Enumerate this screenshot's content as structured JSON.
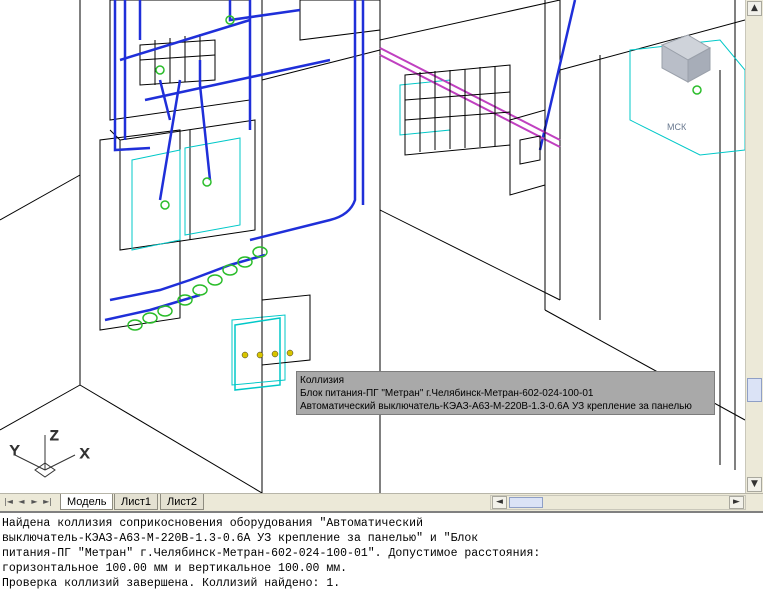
{
  "viewcube": {
    "label": "МСК"
  },
  "ucs": {
    "x": "X",
    "y": "Y",
    "z": "Z"
  },
  "tooltip": {
    "title": "Коллизия",
    "line1": "Блок питания-ПГ \"Метран\" г.Челябинск-Метран-602-024-100-01",
    "line2": "Автоматический выключатель-КЭАЗ-А63-М-220В-1.3-0.6А УЗ крепление за панелью"
  },
  "layout_tabs": [
    {
      "label": "Модель",
      "active": true
    },
    {
      "label": "Лист1",
      "active": false
    },
    {
      "label": "Лист2",
      "active": false
    }
  ],
  "nav_buttons": [
    "first-icon",
    "prev-icon",
    "next-icon",
    "last-icon"
  ],
  "scroll_arrows": {
    "up": "▲",
    "down": "▼",
    "left": "◄",
    "right": "►"
  },
  "command_line": [
    "Найдена коллизия соприкосновения оборудования \"Автоматический",
    "выключатель-КЭАЗ-А63-М-220В-1.3-0.6А УЗ крепление за панелью\" и \"Блок",
    "питания-ПГ \"Метран\" г.Челябинск-Метран-602-024-100-01\". Допустимое расстояния:",
    "горизонтальное 100.00 мм и вертикальное 100.00 мм.",
    "Проверка коллизий завершена. Коллизий найдено: 1."
  ],
  "colors": {
    "wire": "#1f2fd9",
    "cyan": "#00d0d0",
    "green": "#2bbd2b",
    "magenta": "#c040c0",
    "lines": "#000000"
  }
}
